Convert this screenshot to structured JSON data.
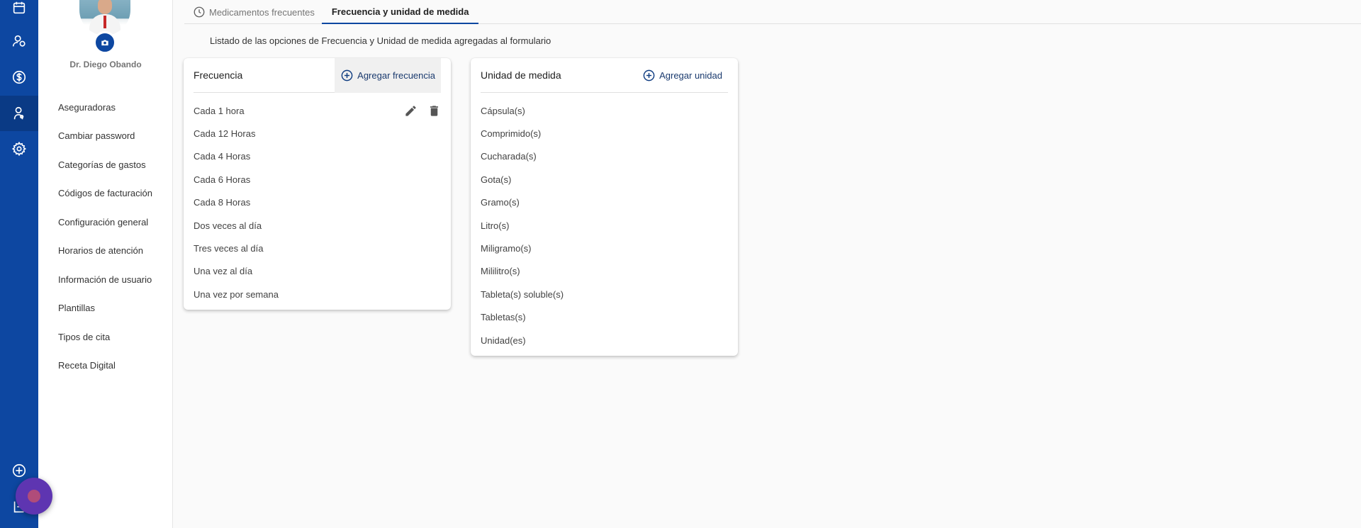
{
  "sidebar_rail": {
    "items": [
      {
        "icon": "calendar-icon"
      },
      {
        "icon": "patients-icon"
      },
      {
        "icon": "dollar-icon"
      },
      {
        "icon": "doctor-icon",
        "active": true
      },
      {
        "icon": "gear-icon"
      },
      {
        "icon": "add-circle-icon"
      },
      {
        "icon": "logout-icon"
      }
    ]
  },
  "profile": {
    "name": "Dr. Diego Obando"
  },
  "nav": {
    "items": [
      {
        "label": "Aseguradoras"
      },
      {
        "label": "Cambiar password"
      },
      {
        "label": "Categorías de gastos"
      },
      {
        "label": "Códigos de facturación"
      },
      {
        "label": "Configuración general"
      },
      {
        "label": "Horarios de atención"
      },
      {
        "label": "Información de usuario"
      },
      {
        "label": "Plantillas"
      },
      {
        "label": "Tipos de cita"
      },
      {
        "label": "Receta Digital"
      }
    ]
  },
  "tabs": [
    {
      "label": "Medicamentos frecuentes",
      "icon": "clock-icon",
      "active": false
    },
    {
      "label": "Frecuencia y unidad de medida",
      "active": true
    }
  ],
  "intro_text": "Listado de las opciones de Frecuencia y Unidad de medida agregadas al formulario",
  "frequency_card": {
    "title": "Frecuencia",
    "add_label": "Agregar frecuencia",
    "items": [
      {
        "label": "Cada 1 hora"
      },
      {
        "label": "Cada 12 Horas"
      },
      {
        "label": "Cada 4 Horas"
      },
      {
        "label": "Cada 6 Horas"
      },
      {
        "label": "Cada 8 Horas"
      },
      {
        "label": "Dos veces al día"
      },
      {
        "label": "Tres veces al día"
      },
      {
        "label": "Una vez al día"
      },
      {
        "label": "Una vez por semana"
      }
    ]
  },
  "unit_card": {
    "title": "Unidad de medida",
    "add_label": "Agregar unidad",
    "items": [
      {
        "label": "Cápsula(s)"
      },
      {
        "label": "Comprimido(s)"
      },
      {
        "label": "Cucharada(s)"
      },
      {
        "label": "Gota(s)"
      },
      {
        "label": "Gramo(s)"
      },
      {
        "label": "Litro(s)"
      },
      {
        "label": "Miligramo(s)"
      },
      {
        "label": "Mililitro(s)"
      },
      {
        "label": "Tableta(s) soluble(s)"
      },
      {
        "label": "Tabletas(s)"
      },
      {
        "label": "Unidad(es)"
      }
    ]
  },
  "colors": {
    "primary": "#0d47a1",
    "fab": "#5e35b1"
  }
}
